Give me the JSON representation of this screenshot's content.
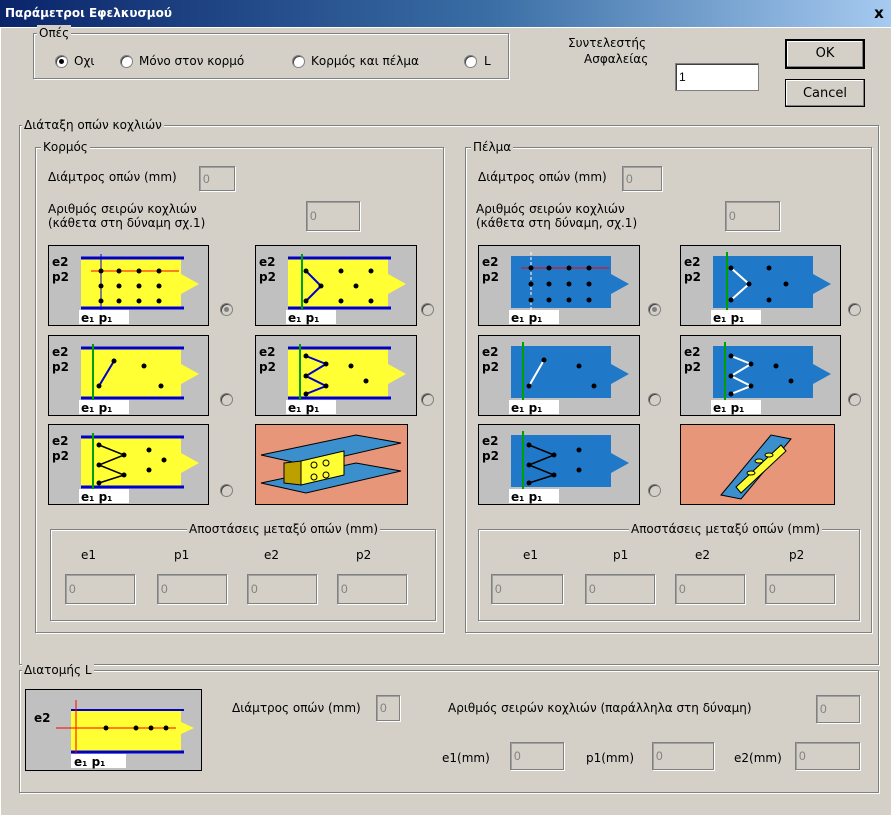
{
  "window": {
    "title": "Παράμετροι Εφελκυσμού",
    "close_label": "x"
  },
  "holes": {
    "legend": "Οπές",
    "options": [
      "Οχι",
      "Μόνο στον κορμό",
      "Κορμός και πέλμα",
      "L"
    ]
  },
  "safety": {
    "label_line1": "Συντελεστής",
    "label_line2": "Ασφαλείας",
    "value": "1"
  },
  "buttons": {
    "ok": "OK",
    "cancel": "Cancel"
  },
  "layout_group": {
    "legend": "Διάταξη οπών κοχλιών"
  },
  "web": {
    "legend": "Κορμός",
    "diameter_label": "Διάμτρος οπών (mm)",
    "diameter_value": "0",
    "rows_label_line1": "Αριθμός σειρών κοχλιών",
    "rows_label_line2": "(κάθετα στη δύναμη σχ.1)",
    "rows_value": "0",
    "spacing_legend": "Αποστάσεις μεταξύ οπών (mm)",
    "spacing_headers": [
      "e1",
      "p1",
      "e2",
      "p2"
    ],
    "spacing_values": [
      "0",
      "0",
      "0",
      "0"
    ]
  },
  "flange": {
    "legend": "Πέλμα",
    "diameter_label": "Διάμτρος οπών (mm)",
    "diameter_value": "0",
    "rows_label_line1": "Αριθμός σειρών κοχλιών",
    "rows_label_line2": "(κάθετα στη δύναμη, σχ.1)",
    "rows_value": "0",
    "spacing_legend": "Αποστάσεις μεταξύ οπών (mm)",
    "spacing_headers": [
      "e1",
      "p1",
      "e2",
      "p2"
    ],
    "spacing_values": [
      "0",
      "0",
      "0",
      "0"
    ]
  },
  "diagram_labels": {
    "e2": "e2",
    "p2": "p2",
    "e1": "e",
    "p1": "p",
    "sub": "1"
  },
  "l_section": {
    "legend": "Διατομής L",
    "diameter_label": "Διάμτρος οπών (mm)",
    "diameter_value": "0",
    "rows_label": "Αριθμός σειρών κοχλιών (παράλληλα στη δύναμη)",
    "rows_value": "0",
    "e1_label": "e1(mm)",
    "e1_value": "0",
    "p1_label": "p1(mm)",
    "p1_value": "0",
    "e2_label": "e2(mm)",
    "e2_value": "0"
  },
  "colors": {
    "web_plate": "#ffff33",
    "flange_plate": "#1f78c8",
    "beam_bg": "#e8967a"
  }
}
